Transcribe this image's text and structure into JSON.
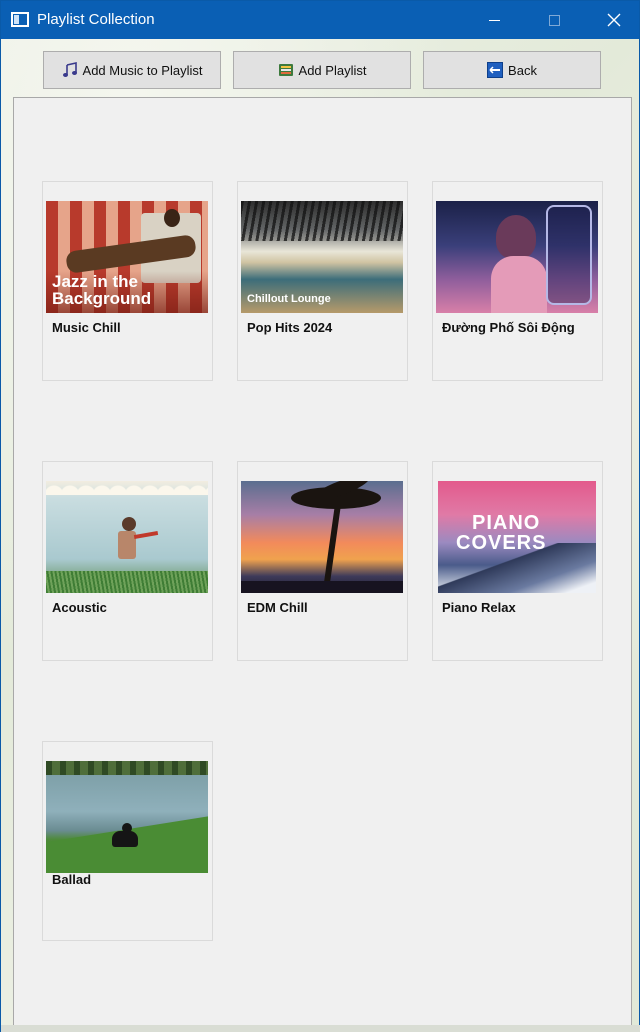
{
  "window": {
    "title": "Playlist Collection"
  },
  "toolbar": {
    "add_music_label": "Add Music to Playlist",
    "add_playlist_label": "Add Playlist",
    "back_label": "Back"
  },
  "playlists": [
    {
      "name": "Music Chill",
      "cover_text_1": "Jazz in the",
      "cover_text_2": "Background"
    },
    {
      "name": "Pop Hits 2024",
      "cover_text_1": "Chillout Lounge"
    },
    {
      "name": "Đường Phố Sôi Động"
    },
    {
      "name": "Acoustic"
    },
    {
      "name": "EDM Chill"
    },
    {
      "name": "Piano Relax",
      "cover_text_1": "PIANO",
      "cover_text_2": "COVERS"
    },
    {
      "name": "Ballad"
    }
  ],
  "colors": {
    "titlebar": "#0a5fb4",
    "panel": "#f0f0f0",
    "button": "#e1e1e1"
  }
}
